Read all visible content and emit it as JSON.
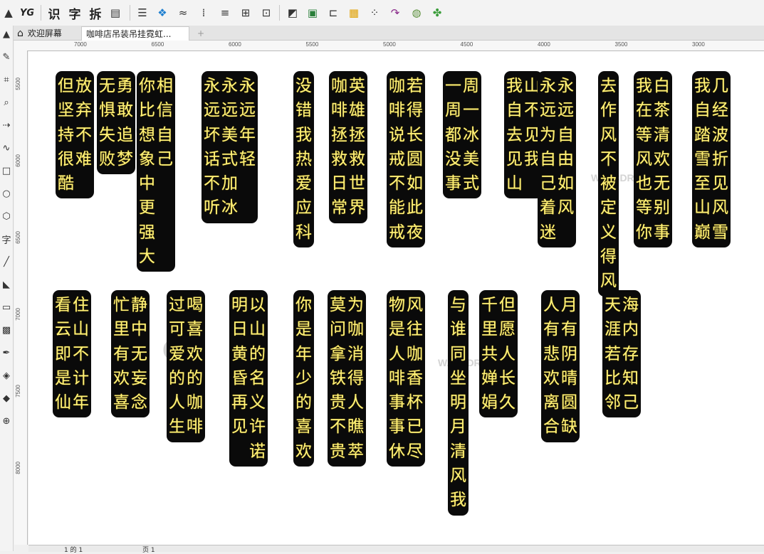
{
  "toolbar": {
    "items": [
      {
        "name": "pick-tool-icon",
        "glyph": "▲"
      },
      {
        "name": "yg-plugin-icon",
        "text": "YG"
      },
      {
        "name": "recognize-button",
        "text": "识"
      },
      {
        "name": "char-button",
        "text": "字"
      },
      {
        "name": "split-button",
        "text": "拆"
      },
      {
        "name": "page-icon",
        "glyph": "▤"
      },
      {
        "name": "list-icon",
        "glyph": "☰"
      },
      {
        "name": "pattern-icon",
        "glyph": "❖"
      },
      {
        "name": "curve-icon",
        "glyph": "≈"
      },
      {
        "name": "distribute-icon",
        "glyph": "⁞"
      },
      {
        "name": "lines-icon",
        "glyph": "≡"
      },
      {
        "name": "align-icon",
        "glyph": "⊞"
      },
      {
        "name": "select-frame-icon",
        "glyph": "⊡"
      },
      {
        "name": "color-shapes-icon",
        "glyph": "◩"
      },
      {
        "name": "image-icon",
        "glyph": "▣"
      },
      {
        "name": "text-columns-icon",
        "glyph": "⊏"
      },
      {
        "name": "grid-icon",
        "glyph": "▦"
      },
      {
        "name": "dots-icon",
        "glyph": "⁘"
      },
      {
        "name": "redo-icon",
        "glyph": "↷"
      },
      {
        "name": "globe-icon",
        "glyph": "◍"
      },
      {
        "name": "puzzle-icon",
        "glyph": "✤"
      }
    ]
  },
  "tabs": [
    {
      "label": "欢迎屏幕",
      "icon": "home-icon"
    },
    {
      "label": "咖啡店吊装吊挂霓虹..."
    }
  ],
  "left_tools": [
    "▲",
    "✎",
    "⌗",
    "⌕",
    "⇢",
    "∿",
    "□",
    "○",
    "⬡",
    "字",
    "╱",
    "◣",
    "▭",
    "▩",
    "✒",
    "◈",
    "◆",
    "⊕"
  ],
  "ruler": {
    "h_ticks": [
      "7000",
      "6500",
      "6000",
      "5500",
      "5000",
      "4500",
      "4000",
      "3500",
      "3000"
    ],
    "v_ticks": [
      "5500",
      "6000",
      "6500",
      "7000",
      "7500",
      "8000"
    ]
  },
  "status": {
    "page_nav": "1 的 1",
    "page_tab": "页 1"
  },
  "watermark": {
    "text": "CD",
    "url": "W.C.CDR.CO"
  },
  "strips": [
    [
      "放弃不难",
      "但坚持很酷"
    ],
    [
      "勇敢追梦",
      "无惧失败"
    ],
    [
      "相信自己",
      "你比想象中更强大"
    ],
    [
      "永远年轻",
      "永远美式加冰",
      "永远坏话不听"
    ],
    [
      "没错我热爱应科"
    ],
    [
      "英雄拯救世界",
      "咖啡拯救日常"
    ],
    [
      "若得长圆如此夜",
      "咖啡说戒不能戒"
    ],
    [
      "周一冰美式",
      "一周都没事"
    ],
    [
      "山不见我",
      "我自去见山"
    ],
    [
      "永远自由如风",
      "永远为自己着迷"
    ],
    [
      "去作风不被定义得风"
    ],
    [
      "白茶清欢无别事",
      "我在等风也等你"
    ],
    [
      "几经波折见风雪",
      "我自踏雪至山巅"
    ],
    [
      "住山不计年",
      "看云即是仙"
    ],
    [
      "静中无妄念",
      "忙里有欢喜"
    ],
    [
      "喝喜欢的咖啡",
      "过可爱的人生"
    ],
    [
      "以山的名义许诺",
      "明日黄昏再见"
    ],
    [
      "你是年少的喜欢"
    ],
    [
      "为咖消得人瞧萃",
      "莫问拿铁贵不贵"
    ],
    [
      "风往咖香杯已尽",
      "物是人啡事事休"
    ],
    [
      "与谁同坐明月清风我"
    ],
    [
      "但愿人长久",
      "千里共婵娟"
    ],
    [
      "月有阴晴圆缺",
      "人有悲欢离合"
    ],
    [
      "海内存知己",
      "天涯若比邻"
    ]
  ]
}
